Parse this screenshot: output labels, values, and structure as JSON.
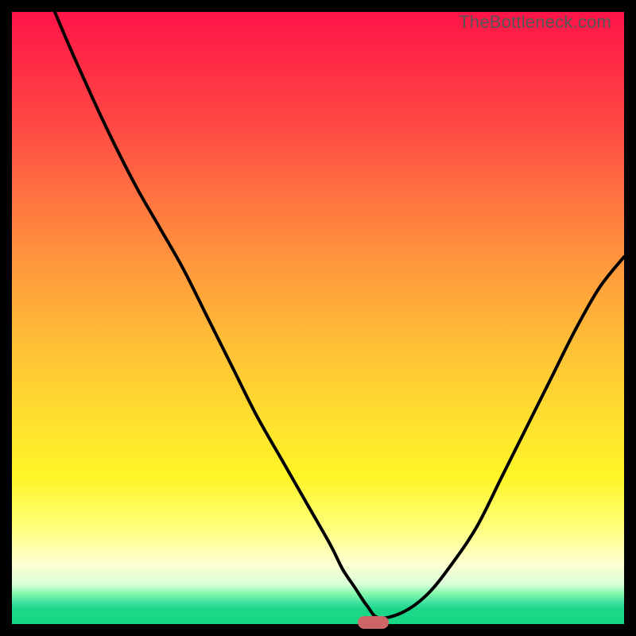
{
  "credit": "TheBottleneck.com",
  "colors": {
    "frame_bg": "#000000",
    "curve": "#000000",
    "marker_fill": "#cc6666"
  },
  "gradient_stops": [
    {
      "offset": 0.0,
      "color": "#ff1448"
    },
    {
      "offset": 0.08,
      "color": "#ff2a46"
    },
    {
      "offset": 0.18,
      "color": "#ff4744"
    },
    {
      "offset": 0.3,
      "color": "#ff7240"
    },
    {
      "offset": 0.42,
      "color": "#ff9a3c"
    },
    {
      "offset": 0.54,
      "color": "#ffbe37"
    },
    {
      "offset": 0.66,
      "color": "#ffde2f"
    },
    {
      "offset": 0.76,
      "color": "#fff526"
    },
    {
      "offset": 0.84,
      "color": "#ffff7a"
    },
    {
      "offset": 0.9,
      "color": "#ffffcf"
    },
    {
      "offset": 0.935,
      "color": "#d9ffd9"
    },
    {
      "offset": 0.95,
      "color": "#86f8ae"
    },
    {
      "offset": 0.965,
      "color": "#40e0a0"
    },
    {
      "offset": 0.975,
      "color": "#1cd788"
    },
    {
      "offset": 1.0,
      "color": "#16d884"
    }
  ],
  "chart_data": {
    "type": "line",
    "title": "",
    "xlabel": "",
    "ylabel": "",
    "xlim": [
      0,
      100
    ],
    "ylim": [
      0,
      100
    ],
    "grid": false,
    "legend": false,
    "series": [
      {
        "name": "bottleneck-curve",
        "x": [
          7,
          10,
          15,
          20,
          24,
          28,
          32,
          36,
          40,
          44,
          48,
          52,
          54,
          56,
          58,
          60,
          64,
          68,
          72,
          76,
          80,
          84,
          88,
          92,
          96,
          100
        ],
        "y": [
          100,
          93,
          82,
          72,
          65,
          58,
          50,
          42,
          34,
          27,
          20,
          13,
          9,
          6,
          3,
          1,
          2,
          5,
          10,
          16,
          24,
          32,
          40,
          48,
          55,
          60
        ]
      }
    ],
    "annotations": [
      {
        "name": "optimal-marker",
        "shape": "pill",
        "x": 59,
        "y": 0,
        "width_pct": 5,
        "height_pct": 2,
        "color": "#cc6666"
      }
    ]
  }
}
